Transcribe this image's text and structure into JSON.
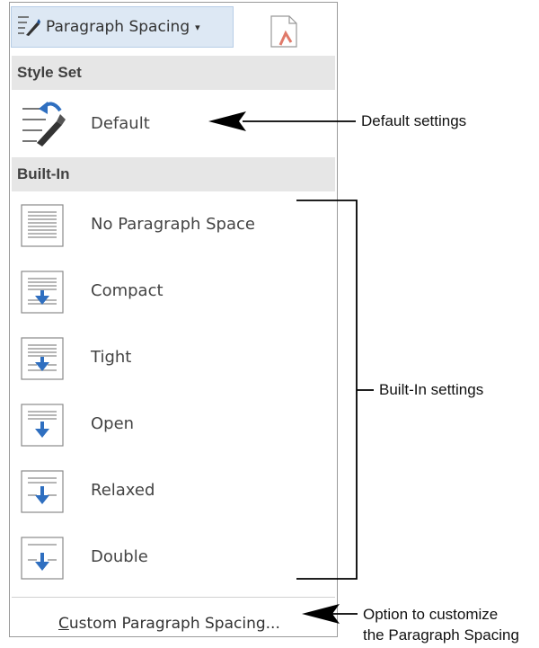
{
  "menu": {
    "button_label": "Paragraph Spacing",
    "caret": "▾",
    "section_style_set": "Style Set",
    "default_item": {
      "label": "Default",
      "icon": "paragraph-spacing-default-icon"
    },
    "section_built_in": "Built-In",
    "built_in_items": [
      {
        "label": "No Paragraph Space",
        "icon": "no-paragraph-space-icon"
      },
      {
        "label": "Compact",
        "icon": "compact-spacing-icon"
      },
      {
        "label": "Tight",
        "icon": "tight-spacing-icon"
      },
      {
        "label": "Open",
        "icon": "open-spacing-icon"
      },
      {
        "label": "Relaxed",
        "icon": "relaxed-spacing-icon"
      },
      {
        "label": "Double",
        "icon": "double-spacing-icon"
      }
    ],
    "custom_first_letter": "C",
    "custom_rest": "ustom Paragraph Spacing..."
  },
  "callouts": {
    "default_settings": "Default settings",
    "built_in_settings": "Built-In settings",
    "option_line1": "Option to customize",
    "option_line2": "the Paragraph Spacing"
  },
  "colors": {
    "accent_blue": "#2f6fc0",
    "button_bg": "#dde8f4",
    "header_bg": "#e6e6e6"
  }
}
